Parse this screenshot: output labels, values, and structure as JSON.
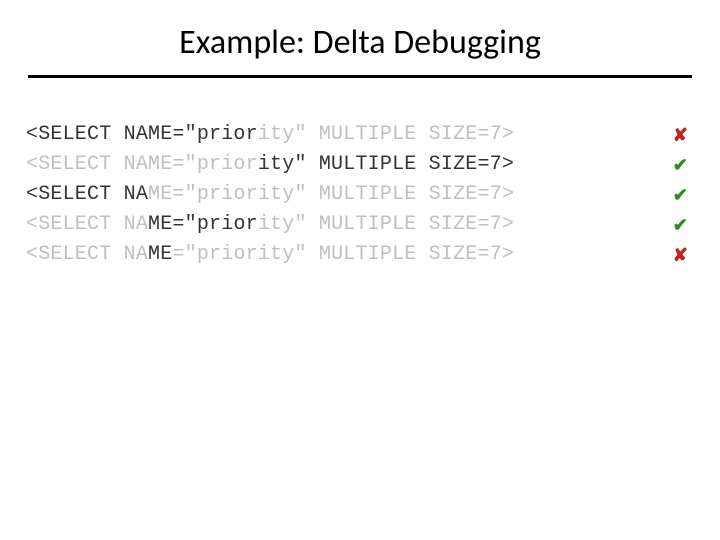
{
  "title": "Example: Delta Debugging",
  "rows": [
    {
      "segments": [
        {
          "text": "<SELECT NAME=\"prior",
          "faded": false
        },
        {
          "text": "ity\" MULTIPLE SIZE=7>",
          "faded": true
        }
      ],
      "result": "fail",
      "glyph": "✘"
    },
    {
      "segments": [
        {
          "text": "<SELECT NAME=\"prior",
          "faded": true
        },
        {
          "text": "ity\" MULTIPLE SIZE=7>",
          "faded": false
        }
      ],
      "result": "pass",
      "glyph": "✔"
    },
    {
      "segments": [
        {
          "text": "<SELECT NA",
          "faded": false
        },
        {
          "text": "ME=\"prior",
          "faded": true
        },
        {
          "text": "ity\" MULTIPLE SIZE=7>",
          "faded": true
        }
      ],
      "result": "pass",
      "glyph": "✔"
    },
    {
      "segments": [
        {
          "text": "<SELECT NA",
          "faded": true
        },
        {
          "text": "ME=\"prior",
          "faded": false
        },
        {
          "text": "ity\" MULTIPLE SIZE=7>",
          "faded": true
        }
      ],
      "result": "pass",
      "glyph": "✔"
    },
    {
      "segments": [
        {
          "text": "<SELECT NA",
          "faded": true
        },
        {
          "text": "ME",
          "faded": false
        },
        {
          "text": "=\"priority\" MULTIPLE SIZE=7>",
          "faded": true
        }
      ],
      "result": "fail",
      "glyph": "✘"
    }
  ]
}
